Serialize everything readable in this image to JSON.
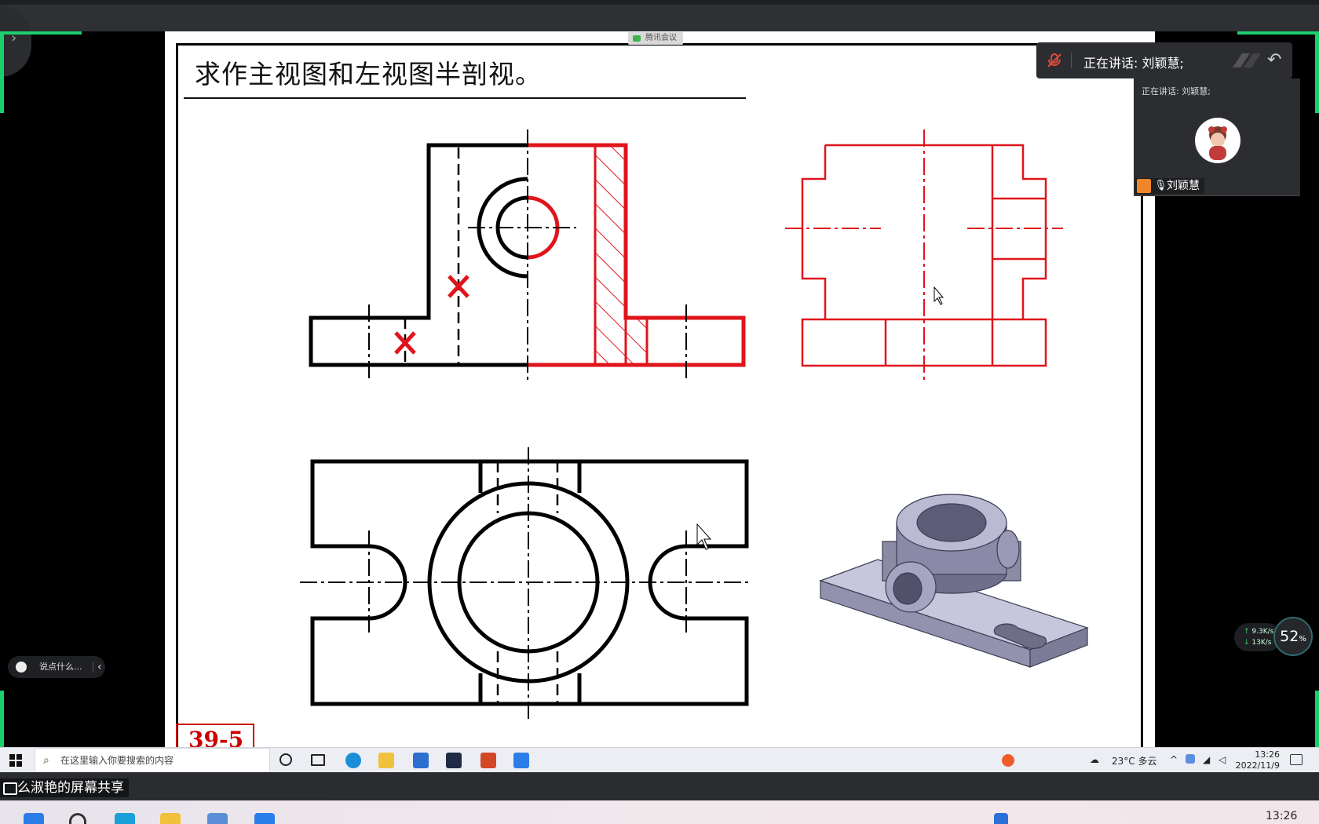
{
  "meeting": {
    "badge": "腾讯会议",
    "expand_glyph": "›",
    "speaking_label": "正在讲话: 刘颖慧;",
    "speaking_small": "正在讲话: 刘颖慧;",
    "participant_name": "刘颖慧",
    "chat_placeholder": "说点什么...",
    "share_caption": "么淑艳的屏幕共享",
    "accent_color": "#1ccf6d"
  },
  "slide": {
    "title": "求作主视图和左视图半剖视。",
    "number": "39-5",
    "drawing_red": "#e0141b"
  },
  "net_widget": {
    "upload": "9.3K/s",
    "download": "13K/s",
    "cpu_percent": "52",
    "percent_sign": "%"
  },
  "remote_taskbar": {
    "search_placeholder": "在这里输入你要搜索的内容",
    "weather": "23°C 多云",
    "time": "13:26",
    "date": "2022/11/9",
    "tray_icons": [
      "chevron-up-icon",
      "network-icon",
      "volume-icon"
    ]
  },
  "local_taskbar": {
    "time": "13:26"
  }
}
